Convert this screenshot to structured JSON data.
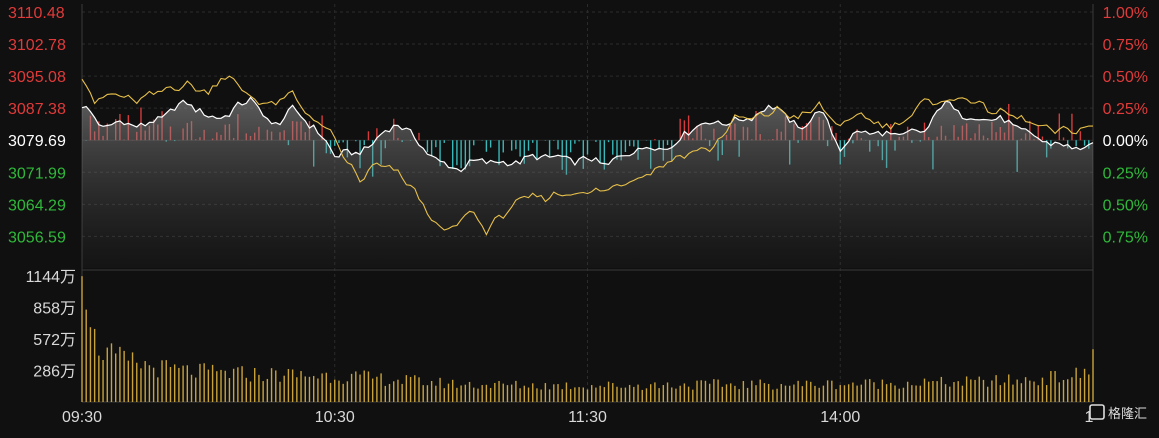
{
  "colors": {
    "background": "#101010",
    "grid": "#2b2b2b",
    "up": "#e03a3a",
    "down": "#2fb93a",
    "neutral": "#ffffff",
    "index_line": "#ffffff",
    "avg_line": "#e8c04a",
    "diff_up_bar": "#d23c3c",
    "diff_down_bar": "#38b8b8",
    "volume_bar": "#c9a23a",
    "axis_text": "#d9d9d9"
  },
  "chart_data": [
    {
      "type": "line",
      "name": "intraday-price",
      "prev_close": 3079.69,
      "ylim": [
        3049.0,
        3110.48
      ],
      "y_ticks": [
        {
          "label": "3110.48",
          "value": 3110.48,
          "tone": "up"
        },
        {
          "label": "3102.78",
          "value": 3102.78,
          "tone": "up"
        },
        {
          "label": "3095.08",
          "value": 3095.08,
          "tone": "up"
        },
        {
          "label": "3087.38",
          "value": 3087.38,
          "tone": "up"
        },
        {
          "label": "3079.69",
          "value": 3079.69,
          "tone": "neutral"
        },
        {
          "label": "3071.99",
          "value": 3071.99,
          "tone": "down"
        },
        {
          "label": "3064.29",
          "value": 3064.29,
          "tone": "down"
        },
        {
          "label": "3056.59",
          "value": 3056.59,
          "tone": "down"
        }
      ],
      "pct_ticks": [
        {
          "label": "1.00%",
          "value": 3110.48,
          "tone": "up"
        },
        {
          "label": "0.75%",
          "value": 3102.78,
          "tone": "up"
        },
        {
          "label": "0.50%",
          "value": 3095.08,
          "tone": "up"
        },
        {
          "label": "0.25%",
          "value": 3087.38,
          "tone": "up"
        },
        {
          "label": "0.00%",
          "value": 3079.69,
          "tone": "neutral"
        },
        {
          "label": "0.25%",
          "value": 3071.99,
          "tone": "down"
        },
        {
          "label": "0.50%",
          "value": 3064.29,
          "tone": "down"
        },
        {
          "label": "0.75%",
          "value": 3056.59,
          "tone": "down"
        }
      ],
      "x_ticks": [
        "09:30",
        "10:30",
        "11:30",
        "14:00",
        "1"
      ],
      "x_tick_minutes": [
        0,
        60,
        120,
        180,
        240
      ],
      "total_minutes": 240,
      "series": [
        {
          "key": "index",
          "x": [
            0,
            5,
            10,
            15,
            20,
            25,
            30,
            35,
            40,
            45,
            50,
            55,
            60,
            62,
            65,
            70,
            75,
            80,
            85,
            90,
            95,
            100,
            105,
            110,
            115,
            120,
            125,
            130,
            135,
            140,
            145,
            150,
            155,
            160,
            165,
            170,
            175,
            180,
            185,
            190,
            195,
            200,
            205,
            210,
            215,
            220,
            225,
            230,
            235,
            240
          ],
          "values": [
            3088,
            3083,
            3084,
            3083,
            3086,
            3089,
            3085,
            3086,
            3090,
            3083,
            3087,
            3083,
            3076,
            3077,
            3076,
            3080,
            3084,
            3079,
            3074,
            3073,
            3075,
            3074,
            3075,
            3076,
            3075,
            3075,
            3074,
            3077,
            3078,
            3078,
            3083,
            3084,
            3084,
            3086,
            3088,
            3082,
            3087,
            3078,
            3082,
            3081,
            3081,
            3082,
            3089,
            3085,
            3085,
            3084,
            3081,
            3079,
            3078,
            3078
          ]
        },
        {
          "key": "weighted_average",
          "x": [
            0,
            3,
            8,
            12,
            15,
            20,
            25,
            30,
            33,
            36,
            40,
            45,
            50,
            55,
            58,
            62,
            66,
            70,
            75,
            80,
            84,
            88,
            92,
            96,
            100,
            105,
            110,
            115,
            120,
            125,
            130,
            135,
            140,
            145,
            150,
            155,
            160,
            165,
            170,
            175,
            180,
            185,
            190,
            195,
            200,
            205,
            210,
            215,
            220,
            225,
            230,
            235,
            240
          ],
          "values": [
            3095,
            3089,
            3091,
            3089,
            3090,
            3092,
            3093,
            3091,
            3095,
            3094,
            3090,
            3088,
            3091,
            3084,
            3083,
            3076,
            3070,
            3074,
            3072,
            3066,
            3059,
            3058,
            3063,
            3058,
            3062,
            3066,
            3066,
            3067,
            3067,
            3068,
            3070,
            3072,
            3075,
            3077,
            3078,
            3085,
            3085,
            3087,
            3085,
            3088,
            3083,
            3086,
            3083,
            3084,
            3089,
            3089,
            3090,
            3087,
            3086,
            3084,
            3082,
            3082,
            3083
          ]
        }
      ]
    },
    {
      "type": "bar",
      "name": "volume",
      "y_ticks": [
        {
          "label": "1144万",
          "value": 1144
        },
        {
          "label": "858万",
          "value": 858
        },
        {
          "label": "572万",
          "value": 572
        },
        {
          "label": "286万",
          "value": 286
        }
      ],
      "ylim": [
        0,
        1200
      ],
      "profile": {
        "x": [
          0,
          1,
          2,
          3,
          5,
          8,
          12,
          18,
          25,
          35,
          45,
          60,
          75,
          90,
          110,
          130,
          150,
          170,
          190,
          210,
          225,
          235,
          239,
          240
        ],
        "values": [
          1144,
          840,
          680,
          560,
          470,
          400,
          360,
          310,
          280,
          260,
          250,
          240,
          200,
          160,
          150,
          150,
          160,
          160,
          170,
          180,
          200,
          240,
          260,
          480
        ]
      }
    }
  ],
  "watermark": {
    "text": "格隆汇"
  }
}
